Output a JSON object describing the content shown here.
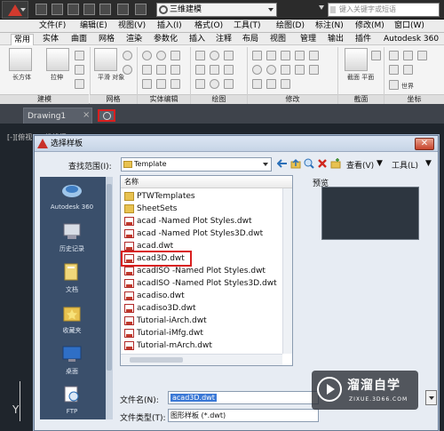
{
  "quick_access": {
    "workspace": "三维建模",
    "search_placeholder": "键入关键字或短语",
    "icons": [
      "new-file-icon",
      "open-file-icon",
      "save-icon",
      "save-as-icon",
      "print-icon",
      "undo-icon",
      "redo-icon"
    ]
  },
  "menubar": {
    "items": [
      "文件(F)",
      "编辑(E)",
      "视图(V)",
      "插入(I)",
      "格式(O)",
      "工具(T)",
      "绘图(D)",
      "标注(N)",
      "修改(M)",
      "窗口(W)"
    ]
  },
  "ribbon_tabs": {
    "active": "常用",
    "items": [
      "常用",
      "实体",
      "曲面",
      "网格",
      "渲染",
      "参数化",
      "插入",
      "注释",
      "布局",
      "视图",
      "管理",
      "输出",
      "插件",
      "Autodesk 360"
    ]
  },
  "ribbon": {
    "big_buttons": [
      "长方体",
      "拉伸",
      "平滑\n对象",
      "截面\n平面"
    ],
    "world": "世界",
    "panels": [
      "建模",
      "网格",
      "实体编辑",
      "绘图",
      "修改",
      "截面",
      "坐标"
    ]
  },
  "doc_tabs": {
    "current": "Drawing1",
    "close_glyph": "×"
  },
  "drawing_area": {
    "view_label": "[-][俯视][二维线框]",
    "axis_label": "Y"
  },
  "dialog": {
    "title": "选择样板",
    "close_glyph": "✕",
    "look_in_label": "查找范围(I):",
    "look_in_value": "Template",
    "views_label": "查看(V)",
    "tools_label": "工具(L)",
    "places": [
      {
        "label": "Autodesk 360",
        "icon": "cloud-icon"
      },
      {
        "label": "历史记录",
        "icon": "history-icon"
      },
      {
        "label": "文档",
        "icon": "documents-icon"
      },
      {
        "label": "收藏夹",
        "icon": "favorites-icon"
      },
      {
        "label": "桌面",
        "icon": "desktop-icon"
      },
      {
        "label": "FTP",
        "icon": "ftp-icon"
      }
    ],
    "list_header": "名称",
    "files": [
      {
        "name": "PTWTemplates",
        "type": "folder"
      },
      {
        "name": "SheetSets",
        "type": "folder"
      },
      {
        "name": "acad -Named Plot Styles.dwt",
        "type": "dwt"
      },
      {
        "name": "acad -Named Plot Styles3D.dwt",
        "type": "dwt"
      },
      {
        "name": "acad.dwt",
        "type": "dwt"
      },
      {
        "name": "acad3D.dwt",
        "type": "dwt"
      },
      {
        "name": "acadISO -Named Plot Styles.dwt",
        "type": "dwt"
      },
      {
        "name": "acadISO -Named Plot Styles3D.dwt",
        "type": "dwt"
      },
      {
        "name": "acadiso.dwt",
        "type": "dwt"
      },
      {
        "name": "acadiso3D.dwt",
        "type": "dwt"
      },
      {
        "name": "Tutorial-iArch.dwt",
        "type": "dwt"
      },
      {
        "name": "Tutorial-iMfg.dwt",
        "type": "dwt"
      },
      {
        "name": "Tutorial-mArch.dwt",
        "type": "dwt"
      }
    ],
    "selected_file": "acad3D.dwt",
    "preview_label": "预览",
    "file_name_label": "文件名(N):",
    "file_name_value": "acad3D.dwt",
    "file_type_label": "文件类型(T):",
    "file_type_value": "图形样板 (*.dwt)"
  },
  "watermark": {
    "title": "溜溜自学",
    "subtitle": "ZIXUE.3D66.COM"
  },
  "colors": {
    "highlight_red": "#d91f1f",
    "selection_blue": "#3a78d6",
    "places_bg": "#3a4f6b"
  }
}
